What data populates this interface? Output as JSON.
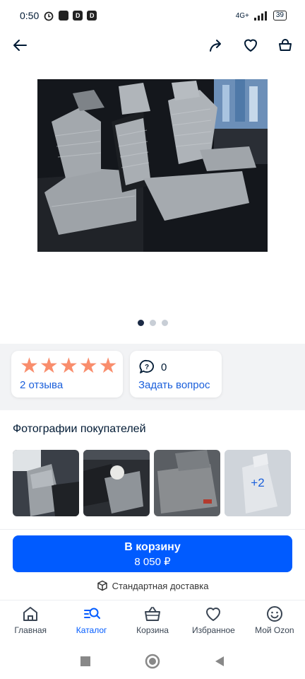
{
  "status_bar": {
    "time": "0:50",
    "network": "4G+",
    "battery": "39"
  },
  "product": {
    "image_alt": "car seat covers"
  },
  "carousel": {
    "total": 3,
    "active": 0
  },
  "rating": {
    "stars": 5,
    "max": 5,
    "reviews_link": "2 отзыва"
  },
  "questions": {
    "count": "0",
    "ask_link": "Задать вопрос"
  },
  "customer_photos": {
    "title": "Фотографии покупателей",
    "more_label": "+2"
  },
  "cart": {
    "button_label": "В корзину",
    "price": "8 050 ₽"
  },
  "delivery": {
    "label": "Стандартная доставка"
  },
  "nav": {
    "items": [
      {
        "label": "Главная",
        "icon": "home-icon"
      },
      {
        "label": "Каталог",
        "icon": "catalog-search-icon"
      },
      {
        "label": "Корзина",
        "icon": "basket-icon"
      },
      {
        "label": "Избранное",
        "icon": "heart-icon"
      },
      {
        "label": "Мой Ozon",
        "icon": "smile-icon"
      }
    ],
    "active": 1
  },
  "colors": {
    "accent": "#005bff",
    "star": "#f98d6c",
    "link": "#1a5fdb"
  }
}
